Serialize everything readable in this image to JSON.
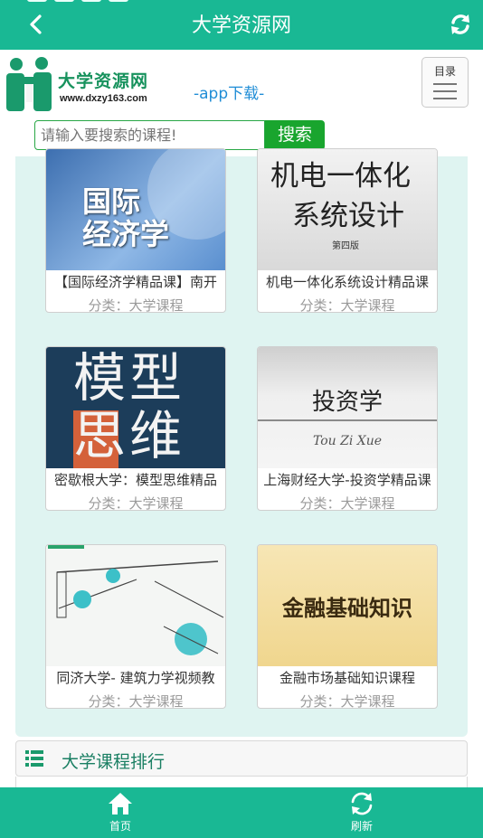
{
  "header": {
    "title": "大学资源网"
  },
  "brand": {
    "name": "大学资源网",
    "url": "www.dxzy163.com",
    "app_link": "-app下载-"
  },
  "menu_button": {
    "label": "目录"
  },
  "search": {
    "placeholder": "请输入要搜索的课程!",
    "button": "搜索"
  },
  "courses": [
    {
      "title": "【国际经济学精品课】南开",
      "category_label": "分类：",
      "category": "大学课程",
      "cover_text": [
        "国际",
        "经济学"
      ]
    },
    {
      "title": "机电一体化系统设计精品课",
      "category_label": "分类：",
      "category": "大学课程",
      "cover_text": [
        "机电一体化",
        "系统设计",
        "第四版"
      ]
    },
    {
      "title": "密歇根大学：模型思维精品",
      "category_label": "分类：",
      "category": "大学课程",
      "cover_text": [
        "模型",
        "思维"
      ]
    },
    {
      "title": "上海财经大学-投资学精品课",
      "category_label": "分类：",
      "category": "大学课程",
      "cover_text": [
        "投资学",
        "Tou Zi Xue"
      ]
    },
    {
      "title": "同济大学- 建筑力学视频教",
      "category_label": "分类：",
      "category": "大学课程",
      "cover_text": []
    },
    {
      "title": "金融市场基础知识课程",
      "category_label": "分类：",
      "category": "大学课程",
      "cover_text": [
        "金融基础知识"
      ]
    }
  ],
  "ranking": {
    "title": "大学课程排行"
  },
  "bottom_nav": [
    {
      "label": "首页",
      "icon": "home-icon"
    },
    {
      "label": "刷新",
      "icon": "refresh-icon"
    }
  ],
  "colors": {
    "primary": "#19b894",
    "search_button": "#19a52e",
    "panel": "#dff4f1",
    "link": "#1f8dd6"
  }
}
